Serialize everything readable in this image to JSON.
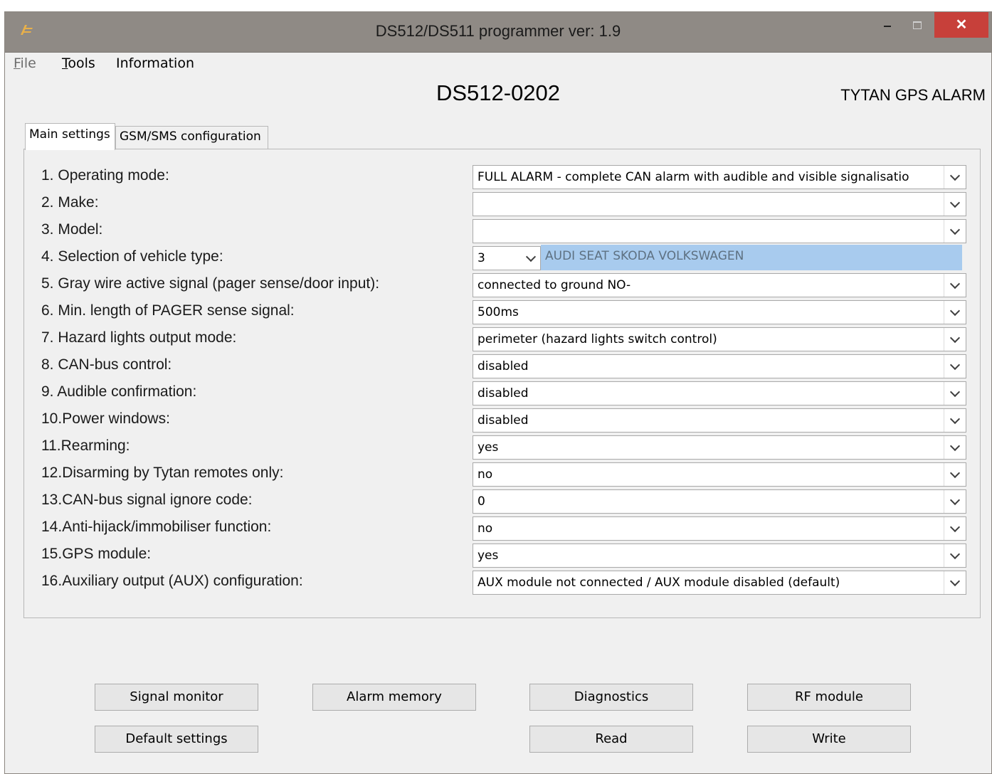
{
  "window": {
    "title": "DS512/DS511 programmer ver:  1.9",
    "close_glyph": "✕"
  },
  "menu": [
    {
      "label": "File",
      "accel": "F",
      "rest": "ile"
    },
    {
      "label": "Tools",
      "accel": "T",
      "rest": "ools"
    },
    {
      "label": "Information",
      "accel": "",
      "rest": "Information"
    }
  ],
  "header": {
    "device_name": "DS512-0202",
    "brand": "TYTAN GPS ALARM"
  },
  "tabs": [
    {
      "label": "Main settings",
      "active": true
    },
    {
      "label": "GSM/SMS configuration",
      "active": false
    }
  ],
  "settings": [
    {
      "num": "1.",
      "label": "Operating mode:",
      "value": "FULL ALARM - complete CAN alarm with audible and visible signalisatio"
    },
    {
      "num": "2.",
      "label": "Make:",
      "value": ""
    },
    {
      "num": "3.",
      "label": "Model:",
      "value": ""
    },
    {
      "num": "4.",
      "label": "Selection of vehicle type:",
      "value": "3",
      "brands": "AUDI SEAT SKODA VOLKSWAGEN"
    },
    {
      "num": "5.",
      "label": "Gray wire active signal (pager sense/door input):",
      "value": "connected to ground NO-"
    },
    {
      "num": "6.",
      "label": "Min. length of PAGER sense signal:",
      "value": "500ms"
    },
    {
      "num": "7.",
      "label": "Hazard lights output mode:",
      "value": "perimeter (hazard lights switch control)"
    },
    {
      "num": "8.",
      "label": "CAN-bus control:",
      "value": "disabled"
    },
    {
      "num": "9.",
      "label": "Audible confirmation:",
      "value": "disabled"
    },
    {
      "num": "10.",
      "label": "Power windows:",
      "value": "disabled"
    },
    {
      "num": "11.",
      "label": "Rearming:",
      "value": "yes"
    },
    {
      "num": "12.",
      "label": "Disarming by Tytan remotes only:",
      "value": "no"
    },
    {
      "num": "13.",
      "label": "CAN-bus signal ignore code:",
      "value": "0"
    },
    {
      "num": "14.",
      "label": "Anti-hijack/immobiliser function:",
      "value": "no"
    },
    {
      "num": "15.",
      "label": "GPS module:",
      "value": "yes"
    },
    {
      "num": "16.",
      "label": "Auxiliary output (AUX) configuration:",
      "value": "AUX module not connected / AUX module disabled (default)"
    }
  ],
  "buttons": {
    "signal_monitor": "Signal monitor",
    "alarm_memory": "Alarm memory",
    "diagnostics": "Diagnostics",
    "rf_module": "RF module",
    "default_settings": "Default settings",
    "read": "Read",
    "write": "Write"
  },
  "colors": {
    "titlebar": "#8f8a85",
    "close_button": "#c7403a",
    "vehicle_brand_highlight": "#a8cbee",
    "logo_accent": "#e8b04a"
  },
  "icons": {
    "app": "app-logo-icon",
    "dropdown": "chevron-down-icon"
  }
}
